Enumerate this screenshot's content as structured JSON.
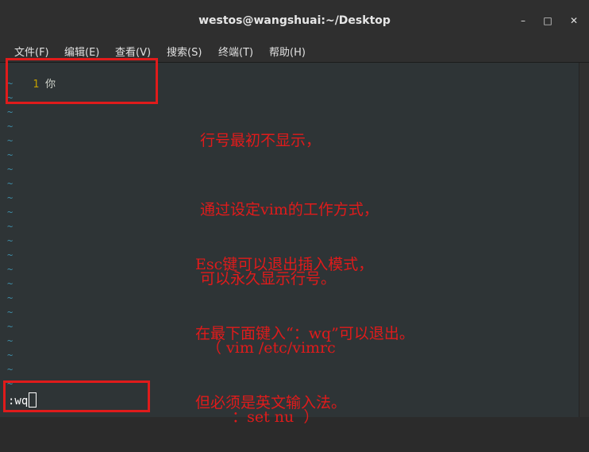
{
  "window": {
    "title": "westos@wangshuai:~/Desktop",
    "controls": {
      "minimize": "–",
      "maximize": "□",
      "close": "✕"
    }
  },
  "menubar": [
    "文件(F)",
    "编辑(E)",
    "查看(V)",
    "搜索(S)",
    "终端(T)",
    "帮助(H)"
  ],
  "editor": {
    "line_number": "1",
    "line_text": "你",
    "tilde": "~",
    "command": ":wq"
  },
  "annotations": {
    "note1": [
      "行号最初不显示，",
      "通过设定vim的工作方式，",
      "可以永久显示行号。",
      "（ vim /etc/vimrc",
      "   ：set nu  ）"
    ],
    "note2": [
      "Esc键可以退出插入模式，",
      "在最下面键入“：wq”可以退出。",
      "但必须是英文输入法。"
    ],
    "color": "#e01b1b"
  }
}
